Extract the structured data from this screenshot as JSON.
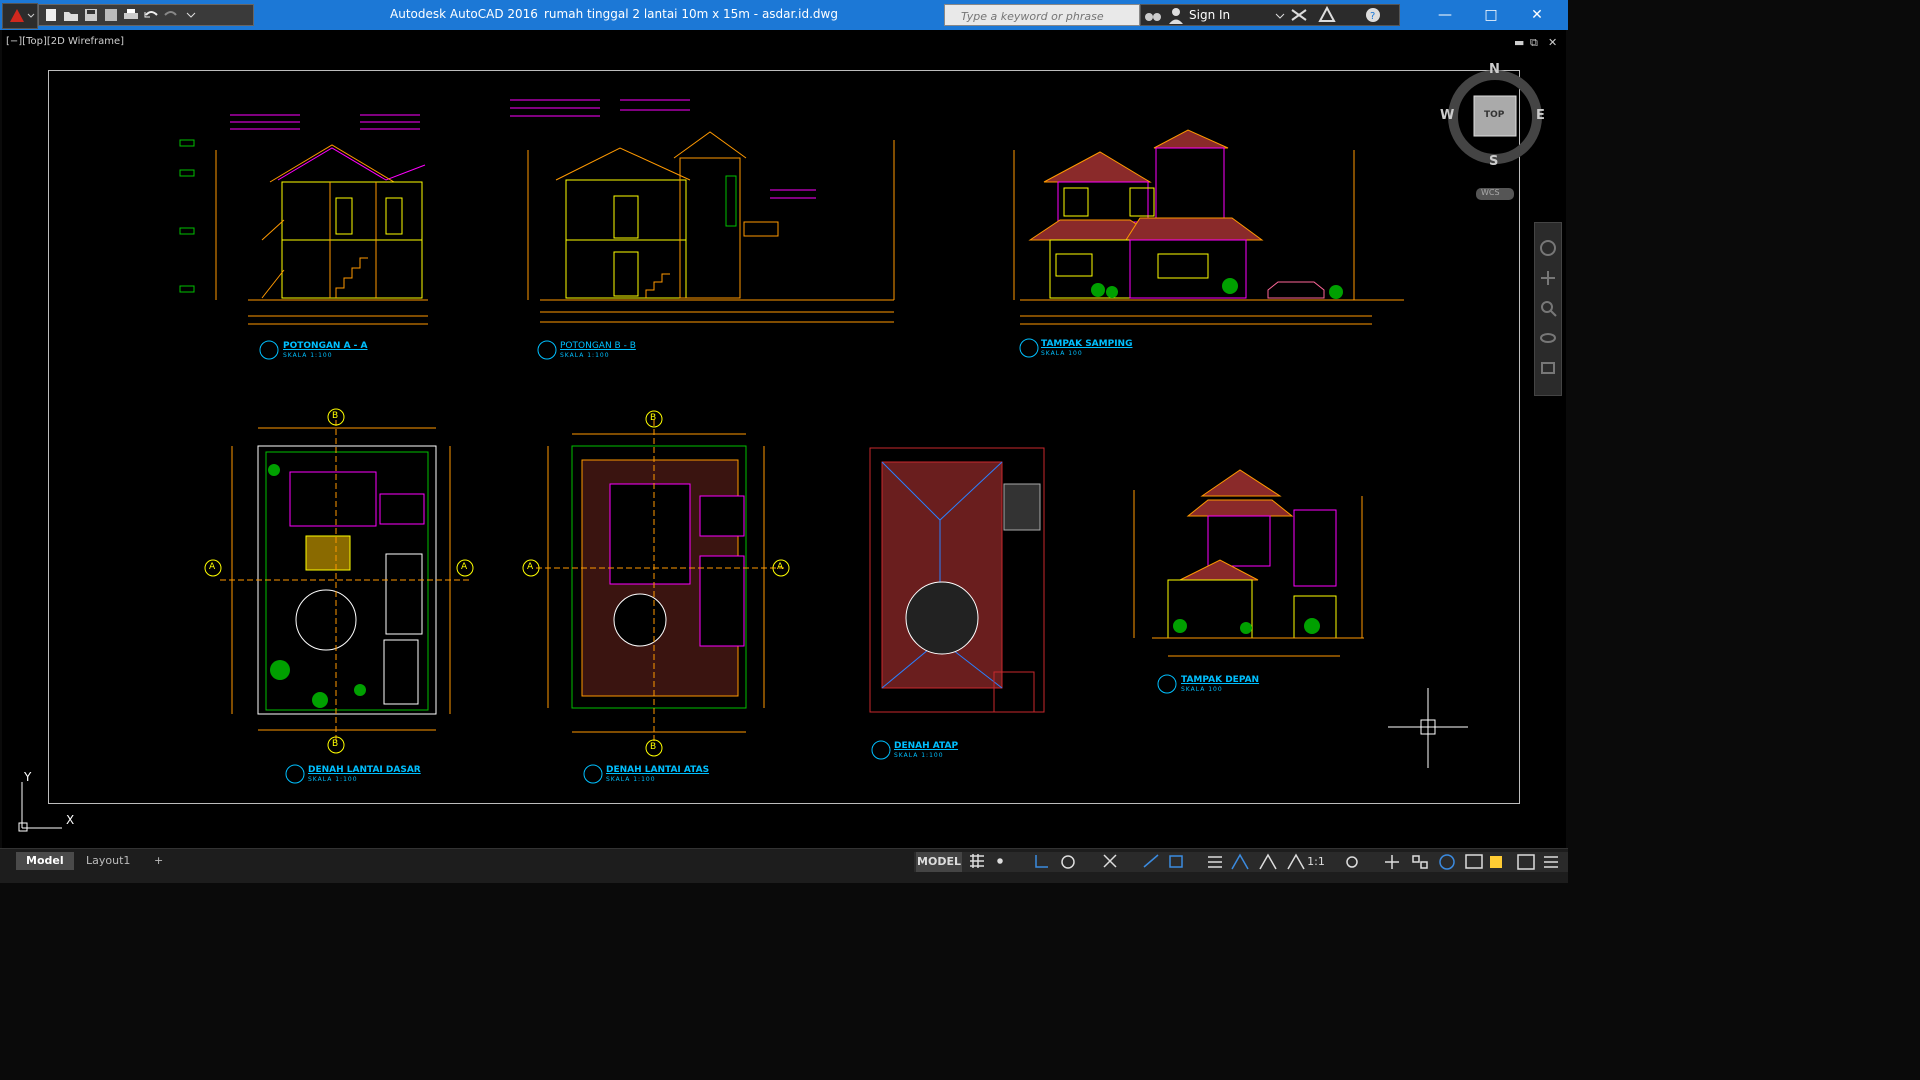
{
  "window": {
    "app_name": "Autodesk AutoCAD 2016",
    "file_name": "rumah tinggal 2 lantai 10m x 15m - asdar.id.dwg"
  },
  "search": {
    "placeholder": "Type a keyword or phrase"
  },
  "account": {
    "sign_in": "Sign In"
  },
  "viewport": {
    "label": "[−][Top][2D Wireframe]"
  },
  "viewcube": {
    "face": "TOP",
    "n": "N",
    "s": "S",
    "e": "E",
    "w": "W",
    "wcs": "WCS"
  },
  "ucs": {
    "x": "X",
    "y": "Y"
  },
  "drawings": {
    "section_a": {
      "title": "POTONGAN A - A",
      "scale": "SKALA 1:100"
    },
    "section_b": {
      "title": "POTONGAN B - B",
      "scale": "SKALA 1:100"
    },
    "side_view": {
      "title": "TAMPAK SAMPING",
      "scale": "SKALA 100"
    },
    "ground_plan": {
      "title": "DENAH LANTAI DASAR",
      "scale": "SKALA 1:100"
    },
    "upper_plan": {
      "title": "DENAH LANTAI ATAS",
      "scale": "SKALA 1:100"
    },
    "roof_plan": {
      "title": "DENAH ATAP",
      "scale": "SKALA 1:100"
    },
    "front_view": {
      "title": "TAMPAK DEPAN",
      "scale": "SKALA 100"
    }
  },
  "grid_marks": {
    "a": "A",
    "b": "B"
  },
  "tabs": {
    "model": "Model",
    "layout1": "Layout1",
    "add": "+"
  },
  "status": {
    "space": "MODEL",
    "scale": "1:1"
  },
  "colors": {
    "title_bar": "#1c78d6",
    "magenta": "#ff00ff",
    "yellow": "#ffff00",
    "cyan": "#00c0ff",
    "red": "#c8282d",
    "green": "#00c000"
  }
}
